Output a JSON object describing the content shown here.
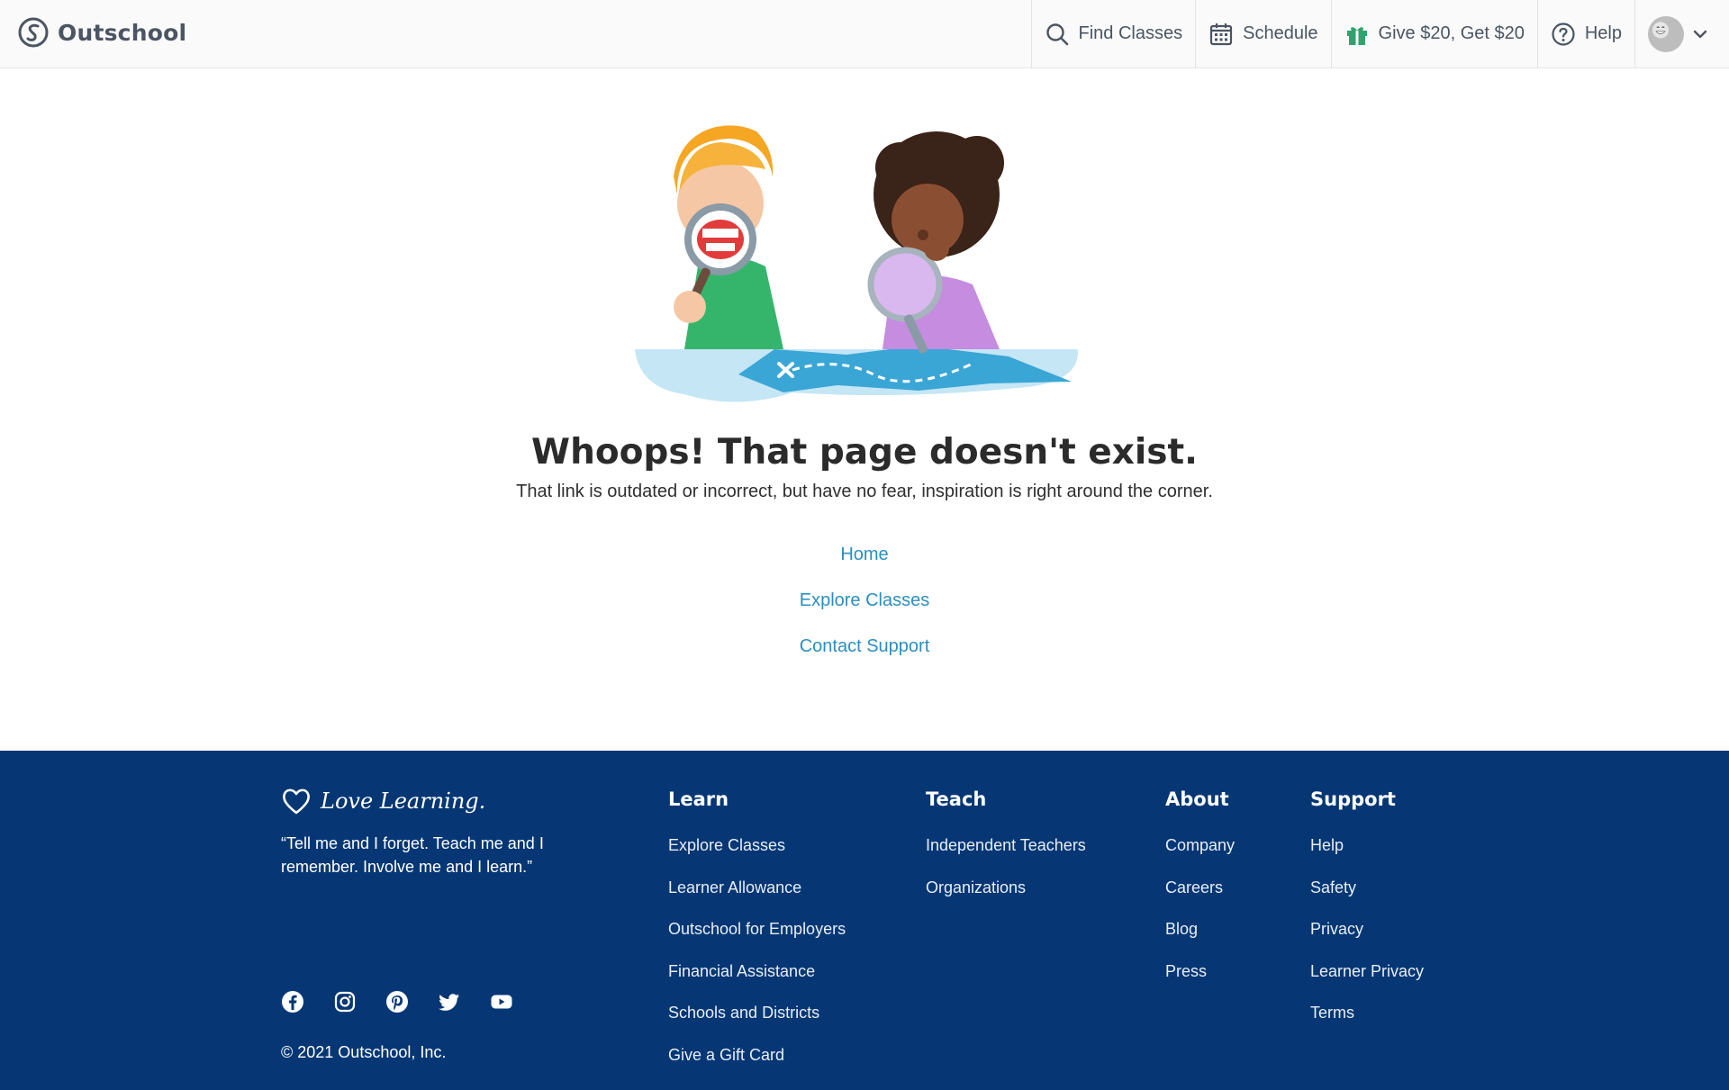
{
  "header": {
    "brand": "Outschool",
    "nav": [
      {
        "label": "Find Classes",
        "icon": "search-icon"
      },
      {
        "label": "Schedule",
        "icon": "calendar-icon"
      },
      {
        "label": "Give $20, Get $20",
        "icon": "gift-icon"
      },
      {
        "label": "Help",
        "icon": "help-icon"
      }
    ],
    "account_icon": "avatar",
    "menu_icon": "chevron-down-icon"
  },
  "error": {
    "title": "Whoops! That page doesn't exist.",
    "message": "That link is outdated or incorrect, but have no fear, inspiration is right around the corner.",
    "links": [
      "Home",
      "Explore Classes",
      "Contact Support"
    ]
  },
  "footer": {
    "tagline": "Love Learning.",
    "quote": "“Tell me and I forget. Teach me and I remember. Involve me and I learn.”",
    "social": [
      "facebook-icon",
      "instagram-icon",
      "pinterest-icon",
      "twitter-icon",
      "youtube-icon"
    ],
    "copyright": "© 2021 Outschool, Inc.",
    "columns": [
      {
        "heading": "Learn",
        "links": [
          "Explore Classes",
          "Learner Allowance",
          "Outschool for Employers",
          "Financial Assistance",
          "Schools and Districts",
          "Give a Gift Card"
        ]
      },
      {
        "heading": "Teach",
        "links": [
          "Independent Teachers",
          "Organizations"
        ]
      },
      {
        "heading": "About",
        "links": [
          "Company",
          "Careers",
          "Blog",
          "Press"
        ]
      },
      {
        "heading": "Support",
        "links": [
          "Help",
          "Safety",
          "Privacy",
          "Learner Privacy",
          "Terms"
        ]
      }
    ]
  },
  "colors": {
    "link": "#2a8fc0",
    "footer_bg": "#063774",
    "gift_green": "#2fa36b",
    "text_dark": "#2b2b2b"
  }
}
